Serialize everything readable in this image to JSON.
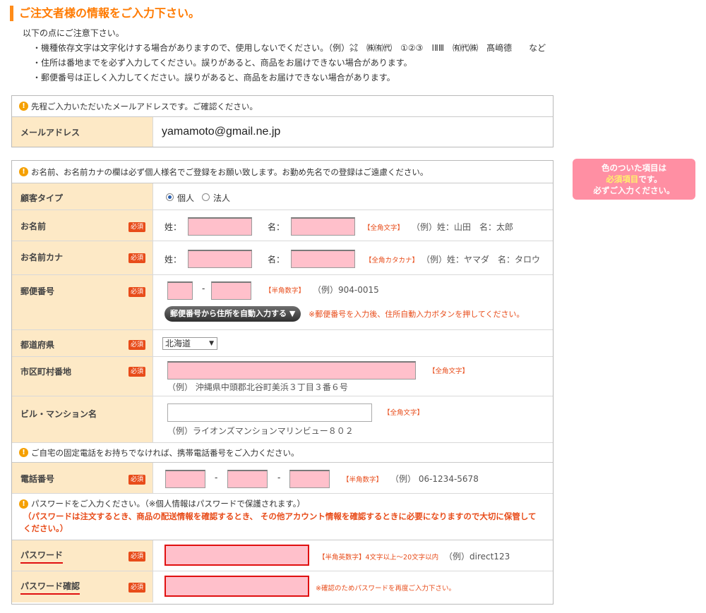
{
  "header": {
    "title": "ご注文者様の情報をご入力下さい。",
    "notice_heading": "以下の点にご注意下さい。",
    "notices": [
      "・機種依存文字は文字化けする場合がありますので、使用しないでください。（例）㌶　㈱㈲㈹　①②③　ⅠⅡⅢ　㈲㈹㈱　髙﨑德　　など",
      "・住所は番地までを必ず入力してください。誤りがあると、商品をお届けできない場合があります。",
      "・郵便番号は正しく入力してください。誤りがあると、商品をお届けできない場合があります。"
    ]
  },
  "email_section": {
    "banner": "先程ご入力いただいたメールアドレスです。ご確認ください。",
    "label": "メールアドレス",
    "value": "yamamoto@gmail.ne.jp"
  },
  "name_section": {
    "banner": "お名前、お名前カナの欄は必ず個人様名でご登録をお願い致します。お勤め先名での登録はご遠慮ください。",
    "customer_type": {
      "label": "顧客タイプ",
      "options": [
        "個人",
        "法人"
      ],
      "selected": "個人"
    },
    "name": {
      "label": "お名前",
      "badge": "必須",
      "last_label": "姓：",
      "first_label": "名：",
      "hint": "【全角文字】",
      "example": "（例）姓：山田　名：太郎"
    },
    "kana": {
      "label": "お名前カナ",
      "badge": "必須",
      "last_label": "姓：",
      "first_label": "名：",
      "hint": "【全角カタカナ】",
      "example": "（例）姓：ヤマダ　名：タロウ"
    },
    "postal": {
      "label": "郵便番号",
      "badge": "必須",
      "dash": "-",
      "hint": "【半角数字】",
      "example": "（例）904-0015",
      "button": "郵便番号から住所を自動入力する ▼",
      "button_note": "※郵便番号を入力後、住所自動入力ボタンを押してください。"
    },
    "prefecture": {
      "label": "都道府県",
      "badge": "必須",
      "selected": "北海道"
    },
    "city": {
      "label": "市区町村番地",
      "badge": "必須",
      "hint": "【全角文字】",
      "example": "（例） 沖縄県中頭郡北谷町美浜３丁目３番６号"
    },
    "building": {
      "label": "ビル・マンション名",
      "hint": "【全角文字】",
      "example": "（例）ライオンズマンションマリンビュー８０２"
    }
  },
  "phone_section": {
    "banner": "ご自宅の固定電話をお持ちでなければ、携帯電話番号をご入力ください。",
    "label": "電話番号",
    "badge": "必須",
    "dash": "-",
    "hint": "【半角数字】",
    "example": "（例） 06-1234-5678"
  },
  "password_section": {
    "banner": "パスワードをご入力ください。（※個人情報はパスワードで保護されます。）",
    "banner_warning": "（パスワードは注文するとき、商品の配送情報を確認するとき、 その他アカウント情報を確認するときに必要になりますので大切に保管してください。）",
    "password": {
      "label": "パスワード",
      "badge": "必須",
      "hint": "【半角英数字】4文字以上〜20文字以内",
      "example": "（例）direct123"
    },
    "confirm": {
      "label": "パスワード確認",
      "badge": "必須",
      "hint": "※確認のためパスワードを再度ご入力下さい。"
    }
  },
  "side_note": {
    "line1": "色のついた項目は",
    "line2_highlight": "必須項目",
    "line2_rest": "です。",
    "line3": "必ずご入力ください。"
  },
  "icons": {
    "warning": "exclamation-circle-icon",
    "dropdown": "chevron-down-icon"
  },
  "colors": {
    "accent": "#ff7a00",
    "required_badge": "#e84c1a",
    "label_bg": "#fde9c6",
    "required_input": "#ffc0cb",
    "side_note_bg": "#ff8fa3"
  }
}
